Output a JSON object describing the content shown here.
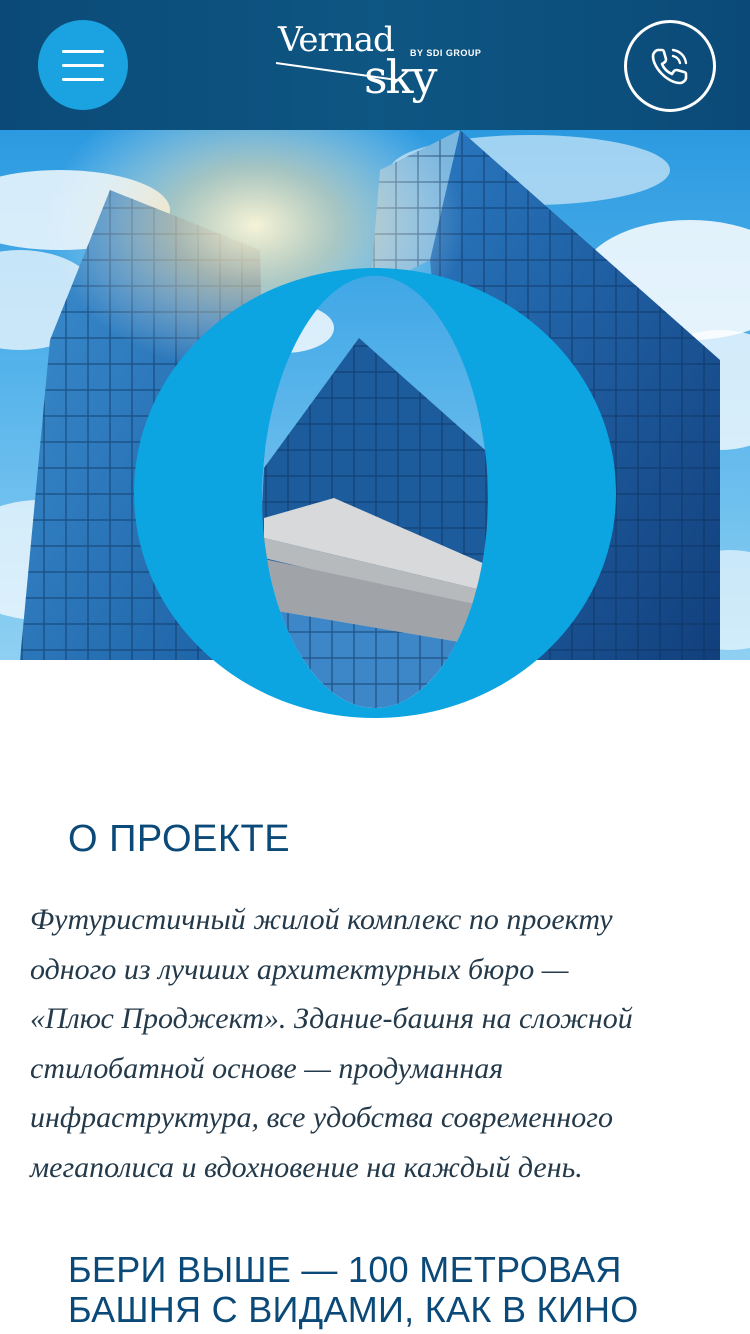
{
  "header": {
    "menu_icon": "hamburger-menu-icon",
    "phone_icon": "phone-call-icon",
    "logo": {
      "line1": "Vernad",
      "line2": "sky",
      "byline": "BY SDI GROUP"
    },
    "background_color": "#0e5683",
    "accent_color": "#1aa3e0"
  },
  "hero": {
    "overlay_letter": "O",
    "overlay_color": "#0da4e2"
  },
  "about": {
    "title": "О ПРОЕКТЕ",
    "lines": [
      "Футуристичный жилой комплекс по проекту",
      "одного из лучших архитектурных бюро —",
      "«Плюс Проджект». Здание-башня на сложной",
      "стилобатной основе — продуманная",
      "инфраструктура, все удобства современного",
      "мегаполиса и вдохновение на каждый день."
    ],
    "subtitle_lines": [
      "БЕРИ ВЫШЕ — 100 МЕТРОВАЯ",
      "БАШНЯ С ВИДАМИ, КАК В КИНО"
    ]
  }
}
